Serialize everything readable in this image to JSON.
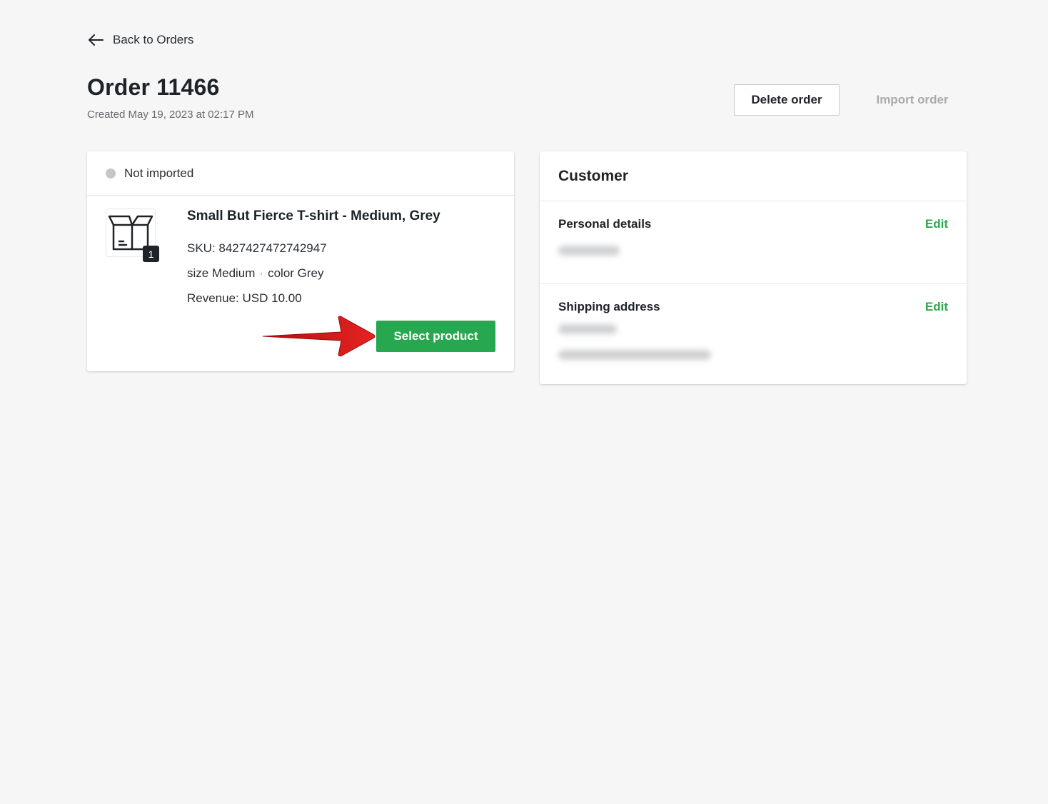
{
  "header": {
    "back_label": "Back to Orders",
    "title": "Order 11466",
    "created": "Created May 19, 2023 at 02:17 PM",
    "delete_label": "Delete order",
    "import_label": "Import order"
  },
  "order_card": {
    "status": "Not imported",
    "product": {
      "name": "Small But Fierce T-shirt - Medium, Grey",
      "sku": "SKU: 8427427472742947",
      "size": "size Medium",
      "separator": "·",
      "color": "color Grey",
      "revenue": "Revenue: USD 10.00",
      "quantity": "1",
      "thumb_icon": "box-icon"
    },
    "select_label": "Select product"
  },
  "customer_card": {
    "title": "Customer",
    "personal": {
      "title": "Personal details",
      "edit_label": "Edit"
    },
    "shipping": {
      "title": "Shipping address",
      "edit_label": "Edit"
    }
  },
  "colors": {
    "accent_green": "#27a74f",
    "edit_green": "#2fa84f",
    "arrow_red": "#d51a1a"
  }
}
